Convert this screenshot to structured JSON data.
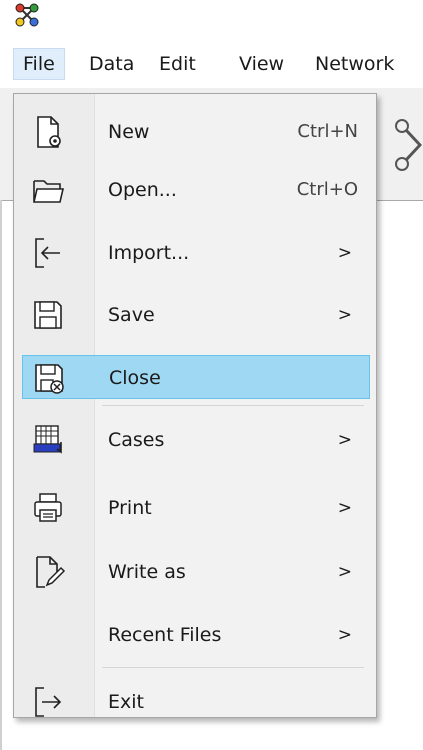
{
  "menubar": {
    "items": [
      {
        "label": "File"
      },
      {
        "label": "Data"
      },
      {
        "label": "Edit"
      },
      {
        "label": "View"
      },
      {
        "label": "Network"
      }
    ]
  },
  "file_menu": {
    "items": [
      {
        "label": "New",
        "shortcut": "Ctrl+N",
        "icon": "new-file-icon"
      },
      {
        "label": "Open...",
        "shortcut": "Ctrl+O",
        "icon": "folder-open-icon"
      },
      {
        "label": "Import...",
        "submenu": true,
        "icon": "import-icon"
      },
      {
        "label": "Save",
        "submenu": true,
        "icon": "save-icon"
      },
      {
        "label": "Close",
        "highlighted": true,
        "icon": "close-file-icon"
      },
      {
        "label": "Cases",
        "submenu": true,
        "icon": "cases-icon"
      },
      {
        "label": "Print",
        "submenu": true,
        "icon": "printer-icon"
      },
      {
        "label": "Write as",
        "submenu": true,
        "icon": "write-icon"
      },
      {
        "label": "Recent Files",
        "submenu": true
      },
      {
        "label": "Exit",
        "icon": "exit-icon"
      }
    ],
    "submenu_arrow": ">"
  },
  "colors": {
    "highlight": "#9fd8f2",
    "highlight_border": "#67c3e7",
    "menu_bg": "#f2f2f2"
  }
}
